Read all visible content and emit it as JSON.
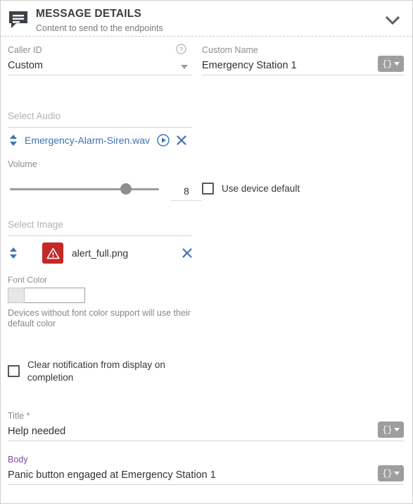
{
  "header": {
    "icon": "message-bubble-icon",
    "title": "MESSAGE DETAILS",
    "subtitle": "Content to send to the endpoints",
    "collapse_icon": "chevron-down-icon"
  },
  "caller_id": {
    "label": "Caller ID",
    "value": "Custom",
    "help_icon": "help-circle-icon",
    "dropdown_icon": "caret-down-icon"
  },
  "custom_name": {
    "label": "Custom Name",
    "value": "Emergency Station 1",
    "token_label": "{}",
    "token_icon": "token-dropdown-icon"
  },
  "audio": {
    "placeholder": "Select Audio",
    "file_name": "Emergency-Alarm-Siren.wav",
    "sort_icon": "sort-updown-icon",
    "play_icon": "play-circle-icon",
    "remove_icon": "close-x-icon"
  },
  "volume": {
    "label": "Volume",
    "value": "8",
    "percent": 78,
    "min": 0,
    "max": 10
  },
  "device_default": {
    "label": "Use device default",
    "checked": false
  },
  "image": {
    "placeholder": "Select Image",
    "file_name": "alert_full.png",
    "sort_icon": "sort-updown-icon",
    "thumb_icon": "warning-triangle-icon",
    "thumb_color": "#c62828",
    "remove_icon": "close-x-icon"
  },
  "font_color": {
    "label": "Font Color",
    "value": "",
    "swatch_color": "#e7e7e7",
    "help_text": "Devices without font color support will use their default color"
  },
  "clear_notification": {
    "label": "Clear notification from display on completion",
    "checked": false
  },
  "title_field": {
    "label": "Title",
    "required": true,
    "value": "Help needed",
    "token_label": "{}",
    "token_icon": "token-dropdown-icon"
  },
  "body_field": {
    "label": "Body",
    "value": "Panic button engaged at Emergency Station 1",
    "focused": true,
    "token_label": "{}",
    "token_icon": "token-dropdown-icon"
  },
  "colors": {
    "link_blue": "#3e72b8",
    "focus_purple": "#7b4fa8",
    "alert_red": "#c62828"
  }
}
